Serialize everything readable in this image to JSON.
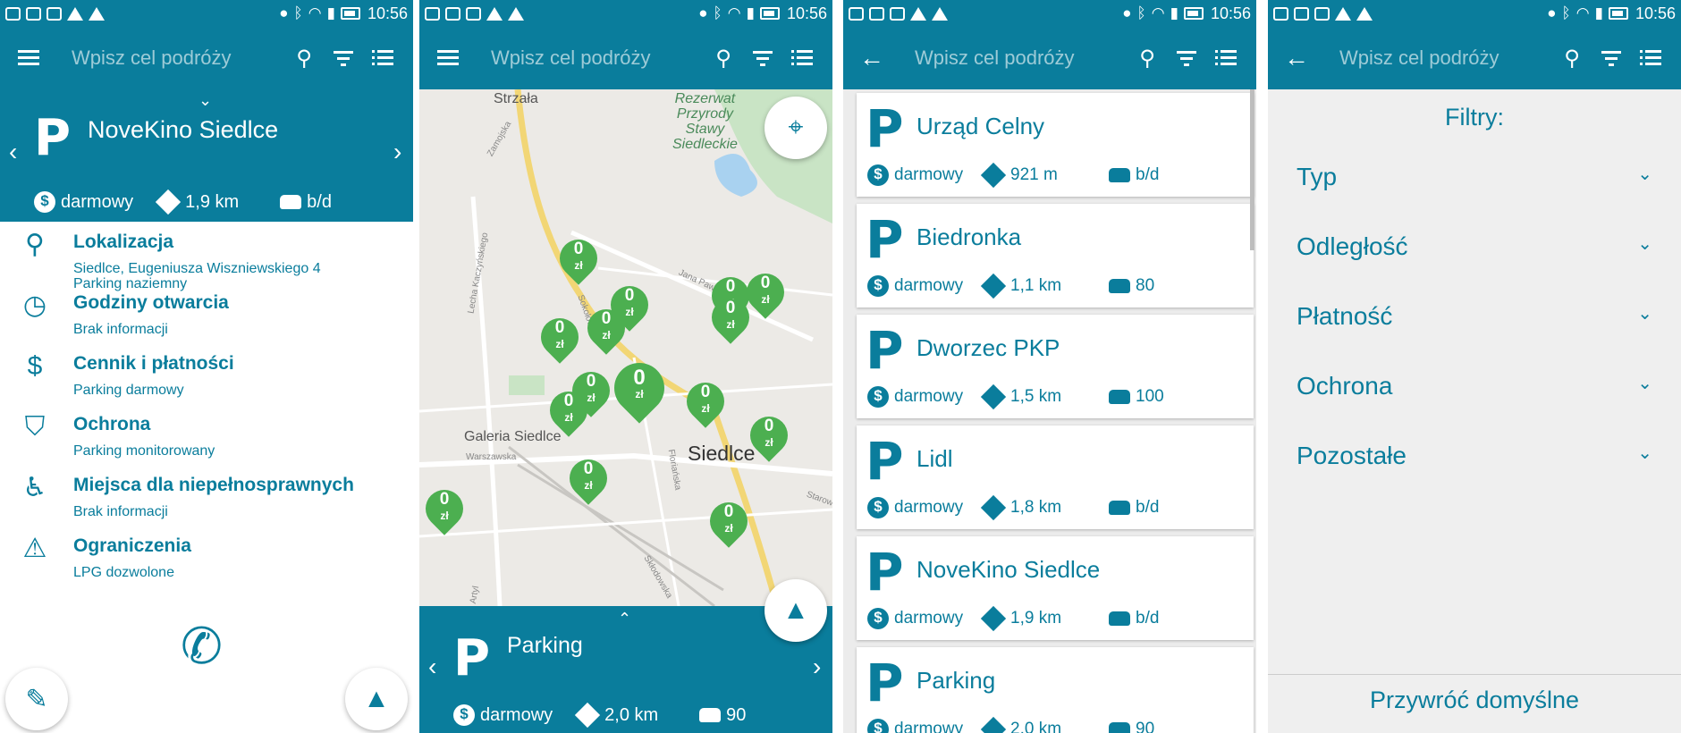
{
  "status_bar": {
    "time": "10:56"
  },
  "search": {
    "placeholder": "Wpisz cel podróży"
  },
  "screen1": {
    "title": "NoveKino Siedlce",
    "payment": "darmowy",
    "distance": "1,9 km",
    "spaces": "b/d",
    "details": [
      {
        "icon": "location-pin-icon",
        "title": "Lokalizacja",
        "lines": [
          "Siedlce, Eugeniusza Wiszniewskiego 4",
          "Parking naziemny"
        ]
      },
      {
        "icon": "clock-icon",
        "title": "Godziny otwarcia",
        "lines": [
          "Brak informacji"
        ]
      },
      {
        "icon": "dollar-icon",
        "title": "Cennik i płatności",
        "lines": [
          "Parking darmowy"
        ]
      },
      {
        "icon": "shield-icon",
        "title": "Ochrona",
        "lines": [
          "Parking monitorowany"
        ]
      },
      {
        "icon": "wheelchair-icon",
        "title": "Miejsca dla niepełnosprawnych",
        "lines": [
          "Brak informacji"
        ]
      },
      {
        "icon": "warning-icon",
        "title": "Ograniczenia",
        "lines": [
          "LPG dozwolone"
        ]
      }
    ]
  },
  "screen2": {
    "map_labels": {
      "strzala": "Strzała",
      "reserve_1": "Rezerwat",
      "reserve_2": "Przyrody",
      "reserve_3": "Stawy",
      "reserve_4": "Siedleckie",
      "galeria": "Galeria Siedlce",
      "siedlce": "Siedlce",
      "warszawska": "Warszawska",
      "sokolowska": "Sokołowska",
      "jana_pawla": "Jana Pawła",
      "lecha": "Lecha Kaczyńskiego",
      "zamojska": "Zamojska",
      "florianska": "Floriańska",
      "starowiejska": "Starowie",
      "sklodowska": "Skłodowska",
      "artyleryjska": "Artyl"
    },
    "pin_value": "0",
    "pin_unit": "zł",
    "title": "Parking",
    "payment": "darmowy",
    "distance": "2,0 km",
    "spaces": "90"
  },
  "screen3": {
    "cards": [
      {
        "title": "Urząd Celny",
        "payment": "darmowy",
        "distance": "921 m",
        "spaces": "b/d"
      },
      {
        "title": "Biedronka",
        "payment": "darmowy",
        "distance": "1,1 km",
        "spaces": "80"
      },
      {
        "title": "Dworzec PKP",
        "payment": "darmowy",
        "distance": "1,5 km",
        "spaces": "100"
      },
      {
        "title": "Lidl",
        "payment": "darmowy",
        "distance": "1,8 km",
        "spaces": "b/d"
      },
      {
        "title": "NoveKino Siedlce",
        "payment": "darmowy",
        "distance": "1,9 km",
        "spaces": "b/d"
      },
      {
        "title": "Parking",
        "payment": "darmowy",
        "distance": "2,0 km",
        "spaces": "90"
      }
    ]
  },
  "screen4": {
    "title": "Filtry:",
    "filters": [
      "Typ",
      "Odległość",
      "Płatność",
      "Ochrona",
      "Pozostałe"
    ],
    "reset": "Przywróć domyślne"
  },
  "colors": {
    "primary": "#0a7d9c",
    "pin": "#4caf50"
  }
}
